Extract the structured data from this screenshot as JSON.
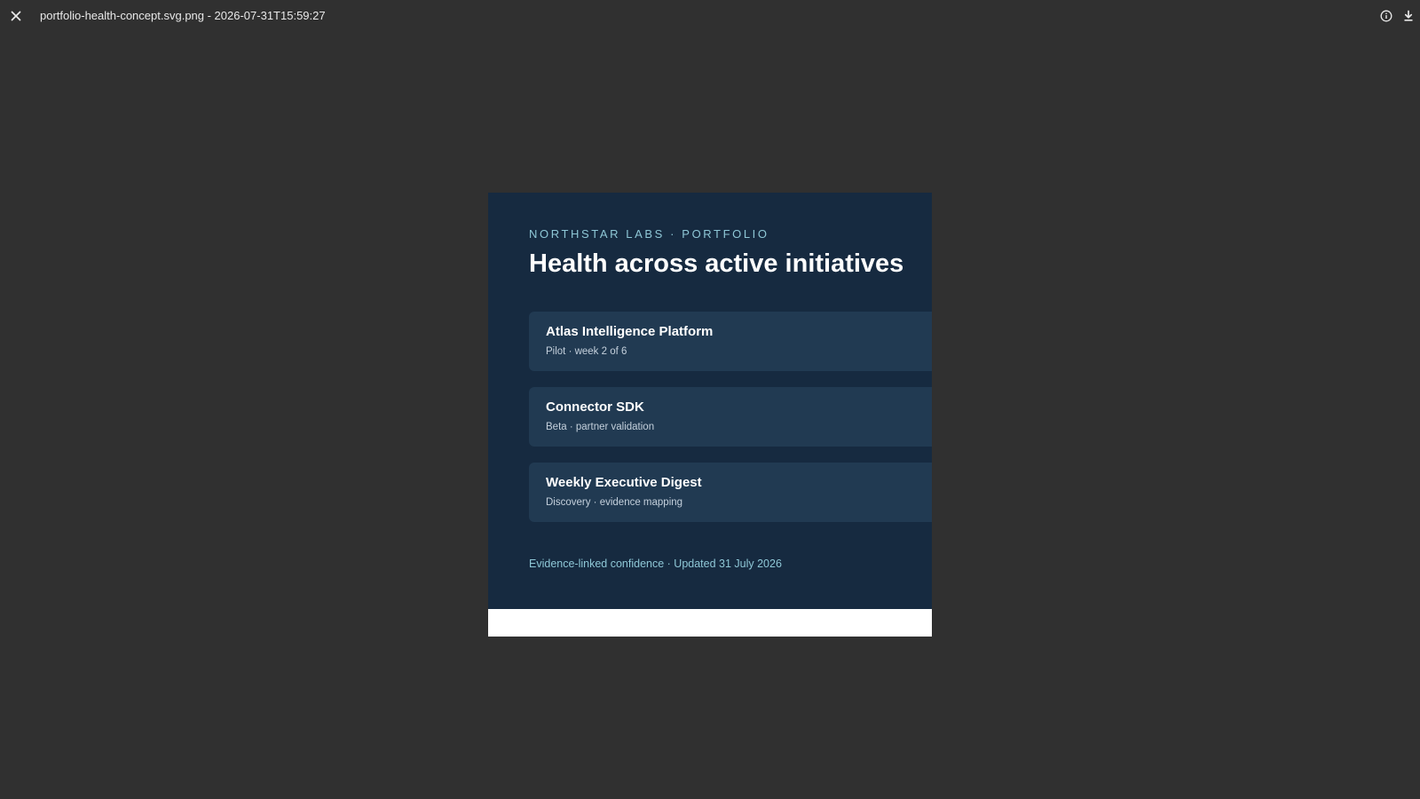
{
  "viewer": {
    "file_title": "portfolio-health-concept.svg.png - 2026-07-31T15:59:27",
    "close_icon": "close-icon",
    "info_icon": "info-icon",
    "download_icon": "download-icon"
  },
  "poster": {
    "eyebrow": "NORTHSTAR LABS · PORTFOLIO",
    "headline": "Health across active initiatives",
    "initiatives": [
      {
        "title": "Atlas Intelligence Platform",
        "subtitle": "Pilot · week 2 of 6"
      },
      {
        "title": "Connector SDK",
        "subtitle": "Beta · partner validation"
      },
      {
        "title": "Weekly Executive Digest",
        "subtitle": "Discovery · evidence mapping"
      }
    ],
    "footer": "Evidence-linked confidence · Updated 31 July 2026",
    "colors": {
      "background": "#162a40",
      "card": "#213a52",
      "accent": "#8ec7d6"
    }
  }
}
